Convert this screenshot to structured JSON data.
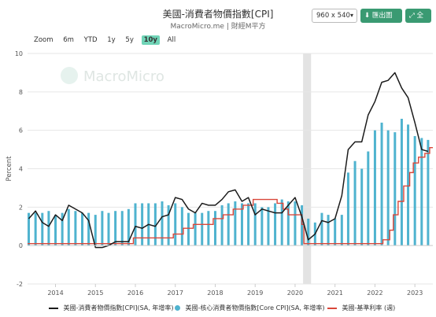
{
  "header": {
    "title": "美國-消費者物價指數[CPI]",
    "subtitle": "MacroMicro.me | 財經M平方"
  },
  "toolbar": {
    "size_value": "960 x 540",
    "export_label": "匯出圖片",
    "fullscreen_label": "全螢"
  },
  "range_buttons": [
    "Zoom",
    "6m",
    "YTD",
    "1y",
    "5y",
    "10y",
    "All"
  ],
  "active_range": "10y",
  "watermark": "MacroMicro",
  "colors": {
    "cpi": "#1b1b1b",
    "core": "#4fb3cf",
    "rate": "#d9473a",
    "shade": "#e3e3e3",
    "grid": "#e6e6e6",
    "active": "#70d4b7",
    "button": "#3a9a72"
  },
  "chart_data": {
    "type": "line",
    "ylabel": "Percent",
    "ylim": [
      -2,
      10
    ],
    "yticks": [
      -2,
      0,
      2,
      4,
      6,
      8,
      10
    ],
    "xlim": [
      2013.3,
      2023.45
    ],
    "xticks": [
      "2014",
      "2015",
      "2016",
      "2017",
      "2018",
      "2019",
      "2020",
      "2021",
      "2022",
      "2023"
    ],
    "shaded_period": [
      2020.2,
      2020.4
    ],
    "series": [
      {
        "name": "美國-消費者物價指數[CPI](SA, 年增率)",
        "style": "line",
        "x": [
          2013.33,
          2013.5,
          2013.67,
          2013.83,
          2014.0,
          2014.17,
          2014.33,
          2014.5,
          2014.67,
          2014.83,
          2015.0,
          2015.17,
          2015.33,
          2015.5,
          2015.67,
          2015.83,
          2016.0,
          2016.17,
          2016.33,
          2016.5,
          2016.67,
          2016.83,
          2017.0,
          2017.17,
          2017.33,
          2017.5,
          2017.67,
          2017.83,
          2018.0,
          2018.17,
          2018.33,
          2018.5,
          2018.67,
          2018.83,
          2019.0,
          2019.17,
          2019.33,
          2019.5,
          2019.67,
          2019.83,
          2020.0,
          2020.17,
          2020.33,
          2020.5,
          2020.67,
          2020.83,
          2021.0,
          2021.17,
          2021.33,
          2021.5,
          2021.67,
          2021.83,
          2022.0,
          2022.17,
          2022.33,
          2022.5,
          2022.67,
          2022.83,
          2023.0,
          2023.17,
          2023.33
        ],
        "y": [
          1.4,
          1.8,
          1.2,
          1.0,
          1.6,
          1.3,
          2.1,
          1.9,
          1.7,
          1.3,
          -0.1,
          -0.1,
          0.0,
          0.2,
          0.2,
          0.2,
          1.0,
          0.9,
          1.1,
          1.0,
          1.5,
          1.6,
          2.5,
          2.4,
          1.9,
          1.7,
          2.2,
          2.1,
          2.1,
          2.4,
          2.8,
          2.9,
          2.3,
          2.5,
          1.6,
          1.9,
          1.8,
          1.7,
          1.7,
          2.1,
          2.5,
          1.5,
          0.3,
          0.6,
          1.3,
          1.2,
          1.4,
          2.6,
          5.0,
          5.4,
          5.4,
          6.8,
          7.5,
          8.5,
          8.6,
          9.0,
          8.2,
          7.7,
          6.4,
          5.0,
          4.9
        ]
      },
      {
        "name": "美國-核心消費者物價指數[Core CPI](SA, 年增率)",
        "style": "bar",
        "x": [
          2013.33,
          2013.5,
          2013.67,
          2013.83,
          2014.0,
          2014.17,
          2014.33,
          2014.5,
          2014.67,
          2014.83,
          2015.0,
          2015.17,
          2015.33,
          2015.5,
          2015.67,
          2015.83,
          2016.0,
          2016.17,
          2016.33,
          2016.5,
          2016.67,
          2016.83,
          2017.0,
          2017.17,
          2017.33,
          2017.5,
          2017.67,
          2017.83,
          2018.0,
          2018.17,
          2018.33,
          2018.5,
          2018.67,
          2018.83,
          2019.0,
          2019.17,
          2019.33,
          2019.5,
          2019.67,
          2019.83,
          2020.0,
          2020.17,
          2020.33,
          2020.5,
          2020.67,
          2020.83,
          2021.0,
          2021.17,
          2021.33,
          2021.5,
          2021.67,
          2021.83,
          2022.0,
          2022.17,
          2022.33,
          2022.5,
          2022.67,
          2022.83,
          2023.0,
          2023.17,
          2023.33
        ],
        "y": [
          1.7,
          1.7,
          1.7,
          1.8,
          1.6,
          1.7,
          1.9,
          1.8,
          1.7,
          1.7,
          1.6,
          1.8,
          1.7,
          1.8,
          1.8,
          1.9,
          2.2,
          2.2,
          2.2,
          2.2,
          2.3,
          2.1,
          2.2,
          2.0,
          1.7,
          1.7,
          1.7,
          1.8,
          1.8,
          2.1,
          2.2,
          2.3,
          2.2,
          2.2,
          2.2,
          2.0,
          2.0,
          2.2,
          2.4,
          2.3,
          2.3,
          2.1,
          1.4,
          1.2,
          1.7,
          1.6,
          1.4,
          1.6,
          3.8,
          4.4,
          4.0,
          4.9,
          6.0,
          6.4,
          6.0,
          5.9,
          6.6,
          6.3,
          5.7,
          5.6,
          5.5
        ]
      },
      {
        "name": "美國-基準利率 (週)",
        "style": "step",
        "x": [
          2013.3,
          2015.95,
          2016.95,
          2017.2,
          2017.45,
          2017.95,
          2018.2,
          2018.45,
          2018.7,
          2018.95,
          2019.55,
          2019.7,
          2019.83,
          2020.17,
          2020.22,
          2022.2,
          2022.37,
          2022.46,
          2022.58,
          2022.72,
          2022.87,
          2022.96,
          2023.09,
          2023.25,
          2023.37,
          2023.45
        ],
        "y": [
          0.1,
          0.4,
          0.6,
          0.9,
          1.1,
          1.4,
          1.6,
          1.9,
          2.1,
          2.4,
          2.2,
          1.9,
          1.6,
          1.1,
          0.1,
          0.3,
          0.8,
          1.6,
          2.3,
          3.1,
          3.8,
          4.3,
          4.6,
          4.8,
          5.1,
          5.1
        ]
      }
    ]
  }
}
